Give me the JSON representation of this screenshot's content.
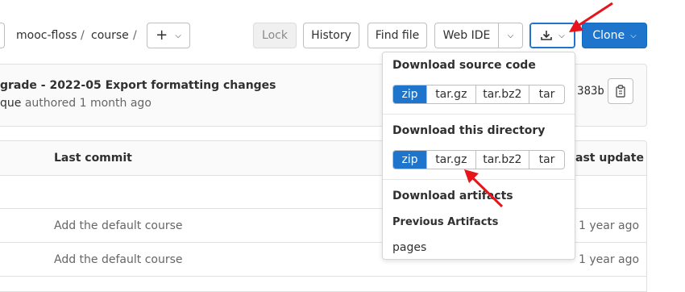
{
  "breadcrumb": {
    "items": [
      "mooc-floss",
      "course"
    ],
    "separator": "/"
  },
  "toolbar": {
    "lock": "Lock",
    "history": "History",
    "find_file": "Find file",
    "web_ide": "Web IDE",
    "clone": "Clone"
  },
  "commit": {
    "message": "grade - 2022-05 Export formatting changes",
    "author": "que",
    "authored_text": "authored 1 month ago",
    "sha_fragment": "383b"
  },
  "table": {
    "headers": {
      "last_commit": "Last commit",
      "last_update": "ast update"
    },
    "rows": [
      {
        "commit": "Add the default course",
        "updated": "1 year ago"
      },
      {
        "commit": "Add the default course",
        "updated": "1 year ago"
      }
    ]
  },
  "download_menu": {
    "source_heading": "Download source code",
    "directory_heading": "Download this directory",
    "artifacts_heading": "Download artifacts",
    "previous_artifacts": "Previous Artifacts",
    "artifact_item": "pages",
    "formats": [
      "zip",
      "tar.gz",
      "tar.bz2",
      "tar"
    ],
    "selected_format": "zip"
  },
  "colors": {
    "primary": "#1f75cb",
    "annotation_arrow": "#e8141b"
  }
}
